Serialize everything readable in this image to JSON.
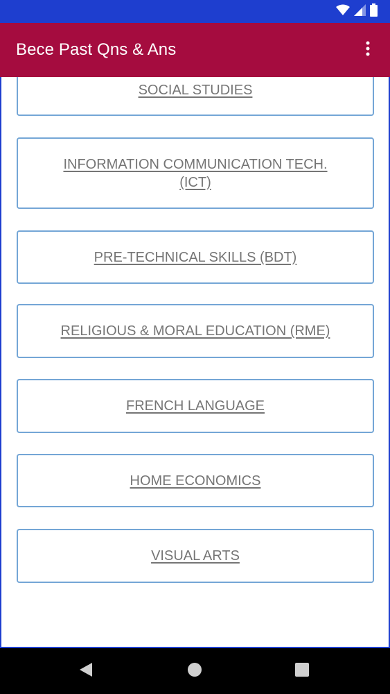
{
  "app": {
    "title": "Bece Past Qns & Ans"
  },
  "status_bar": {
    "icons": [
      "wifi-icon",
      "signal-icon",
      "battery-icon"
    ]
  },
  "subjects": [
    "SOCIAL STUDIES",
    "INFORMATION COMMUNICATION TECH. (ICT)",
    "PRE-TECHNICAL SKILLS (BDT)",
    "RELIGIOUS & MORAL EDUCATION (RME)",
    "FRENCH LANGUAGE",
    "HOME ECONOMICS",
    "VISUAL ARTS"
  ],
  "navigation": {
    "icons": [
      "back-icon",
      "home-icon",
      "recents-icon"
    ]
  },
  "colors": {
    "status_bar": "#1e3ecf",
    "app_bar": "#a50c3f",
    "card_border": "#74a6d6",
    "card_text": "#757575",
    "nav_bar": "#000000"
  }
}
